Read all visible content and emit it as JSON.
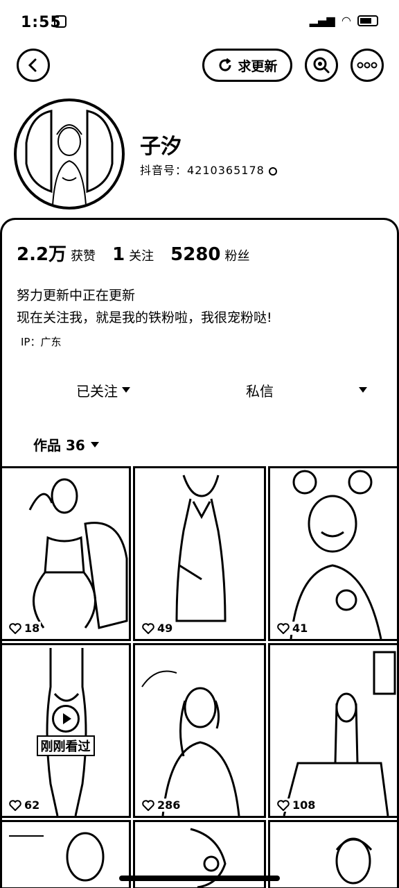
{
  "status_bar": {
    "time": "1:55",
    "battery_level": 0.6
  },
  "header": {
    "update_button": "求更新"
  },
  "profile": {
    "nickname": "子汐",
    "account_label": "抖音号：",
    "account_id": "4210365178"
  },
  "stats": {
    "likes_num": "2.2万",
    "likes_label": "获赞",
    "following_num": "1",
    "following_label": "关注",
    "followers_num": "5280",
    "followers_label": "粉丝"
  },
  "bio": {
    "line1": "努力更新中正在更新",
    "line2": "现在关注我，就是我的铁粉啦，我很宠粉哒!",
    "ip": "IP：广东"
  },
  "actions": {
    "follow": "已关注",
    "message": "私信"
  },
  "works": {
    "tab_label": "作品 36"
  },
  "videos": [
    {
      "likes": "18"
    },
    {
      "likes": "49"
    },
    {
      "likes": "41"
    },
    {
      "likes": "62",
      "watched": "刚刚看过"
    },
    {
      "likes": "286"
    },
    {
      "likes": "108"
    }
  ],
  "icons": [
    "back-icon",
    "refresh-icon",
    "search-icon",
    "more-icon",
    "copy-icon",
    "heart-icon",
    "play-icon",
    "caret-down-icon"
  ]
}
